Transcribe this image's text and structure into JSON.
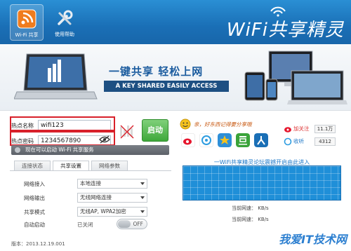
{
  "header": {
    "tabs": [
      {
        "label": "Wi-Fi 共享",
        "icon": "wifi-share-icon"
      },
      {
        "label": "使用帮助",
        "icon": "tools-icon"
      }
    ],
    "brand": "WiFi共享精灵"
  },
  "banner": {
    "slogan": "一键共享 轻松上网",
    "subtitle": "A KEY SHARED EASILY ACCESS"
  },
  "form": {
    "ssid_label": "热点名称",
    "ssid_value": "wifi123",
    "password_label": "热点密码",
    "password_value": "1234567890",
    "start_button": "启动",
    "status_text": "现在可以启动 Wi-Fi 共享服务"
  },
  "tabs": [
    "连接状态",
    "共享设置",
    "网络参数"
  ],
  "settings": {
    "rows": [
      {
        "label": "网络接入",
        "value": "本地连接"
      },
      {
        "label": "网络输出",
        "value": "无线网络连接"
      },
      {
        "label": "共享模式",
        "value": "无线AP, WPA2加密"
      }
    ],
    "autostart_label": "自动启动",
    "autostart_state": "已关闭",
    "toggle_label": "OFF"
  },
  "version": "版本：2013.12.19.001",
  "right": {
    "promo": "亲，好东西记得要分享哦",
    "follow_label": "加关注",
    "follow_count": "11.1万",
    "favorite_label": "收听",
    "favorite_count": "4312",
    "forum_text": "一WiFi共享精灵论坛震撼开启由此进入",
    "rate_up_label": "当前网速：",
    "rate_up_unit": "KB/s",
    "rate_down_label": "当前网速：",
    "rate_down_unit": "KB/s",
    "watermark": "我爱IT技术网"
  },
  "colors": {
    "header": "#1a6fb6",
    "accent": "#1f8fd8",
    "start": "#3fa83a",
    "highlight": "#d8202a"
  }
}
